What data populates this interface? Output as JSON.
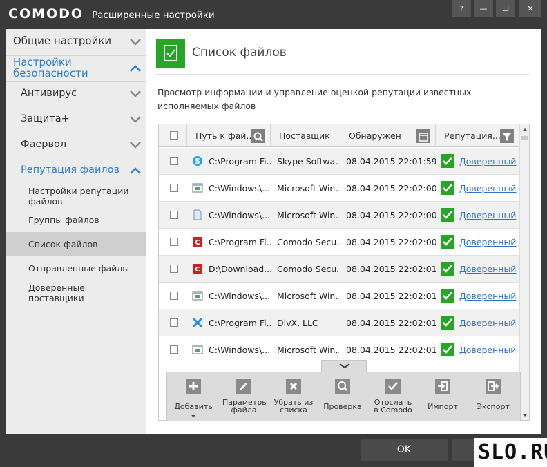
{
  "app": {
    "logo": "COMODO",
    "title": "Расширенные настройки"
  },
  "window_buttons": [
    "?",
    "—",
    "☐",
    "✕"
  ],
  "sidebar": {
    "general": "Общие настройки",
    "security": "Настройки безопасности",
    "antivirus": "Антивирус",
    "defense": "Защита+",
    "firewall": "Фаервол",
    "reputation": "Репутация файлов",
    "rep_settings": "Настройки репутации файлов",
    "file_groups": "Группы файлов",
    "file_list": "Список файлов",
    "submitted": "Отправленные файлы",
    "trusted_vendors": "Доверенные поставщики"
  },
  "main": {
    "title": "Список файлов",
    "description": "Просмотр информации и управление оценкой репутации известных исполняемых файлов"
  },
  "table": {
    "headers": {
      "path": "Путь к фай...",
      "vendor": "Поставщик",
      "found": "Обнаружен",
      "reputation": "Репутация..."
    },
    "rows": [
      {
        "icon": "skype-icon",
        "path": "C:\\Program Fi...",
        "vendor": "Skype Softwa...",
        "date": "08.04.2015 22:01:59",
        "rep": "Доверенный"
      },
      {
        "icon": "window-icon",
        "path": "C:\\Windows\\...",
        "vendor": "Microsoft Win...",
        "date": "08.04.2015 22:02:00",
        "rep": "Доверенный"
      },
      {
        "icon": "document-icon",
        "path": "C:\\Windows\\...",
        "vendor": "Microsoft Win...",
        "date": "08.04.2015 22:02:00",
        "rep": "Доверенный"
      },
      {
        "icon": "comodo-icon",
        "path": "C:\\Program Fi...",
        "vendor": "Comodo Secu...",
        "date": "08.04.2015 22:02:00",
        "rep": "Доверенный"
      },
      {
        "icon": "comodo-icon",
        "path": "D:\\Download...",
        "vendor": "Comodo Secu...",
        "date": "08.04.2015 22:02:01",
        "rep": "Доверенный"
      },
      {
        "icon": "window-icon",
        "path": "C:\\Windows\\...",
        "vendor": "Microsoft Win...",
        "date": "08.04.2015 22:02:01",
        "rep": "Доверенный"
      },
      {
        "icon": "divx-icon",
        "path": "C:\\Program Fi...",
        "vendor": "DivX, LLC",
        "date": "08.04.2015 22:02:01",
        "rep": "Доверенный"
      },
      {
        "icon": "window-icon",
        "path": "C:\\Windows\\...",
        "vendor": "Microsoft Win...",
        "date": "08.04.2015 22:02:01",
        "rep": "Доверенный"
      }
    ]
  },
  "toolbar": {
    "add": "Добавить",
    "file_params": "Параметры файла",
    "remove": "Убрать из списка",
    "check": "Проверка",
    "send": "Отослать в Comodo",
    "import": "Импорт",
    "export": "Экспорт"
  },
  "footer": {
    "ok": "OK"
  },
  "watermark": "SLO.RU"
}
